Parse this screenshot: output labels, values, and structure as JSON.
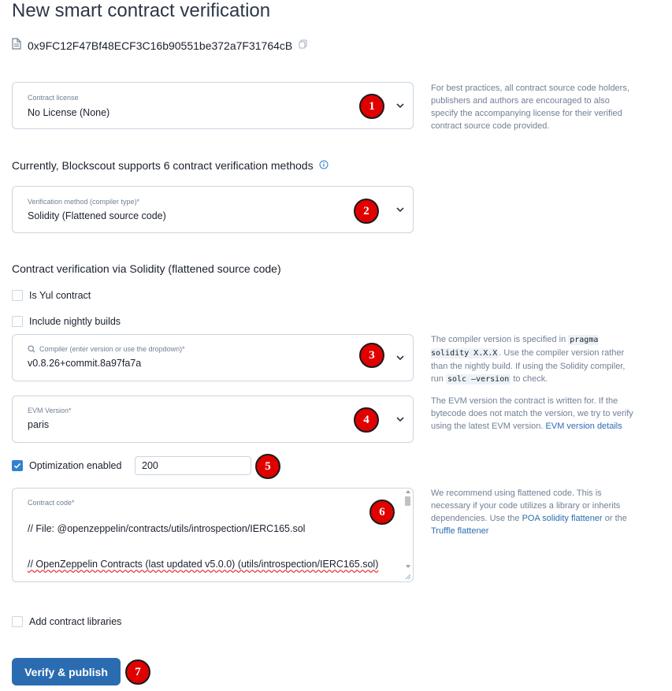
{
  "page": {
    "title": "New smart contract verification"
  },
  "address": {
    "value": "0x9FC12F47Bf48ECF3C16b90551be372a7F31764cB"
  },
  "license": {
    "label": "Contract license",
    "value": "No License (None)",
    "help": "For best practices, all contract source code holders, publishers and authors are encouraged to also specify the accompanying license for their verified contract source code provided."
  },
  "methods_heading": "Currently, Blockscout supports 6 contract verification methods",
  "method": {
    "label": "Verification method (compiler type)*",
    "value": "Solidity (Flattened source code)"
  },
  "section_heading": "Contract verification via Solidity (flattened source code)",
  "checkboxes": {
    "yul": "Is Yul contract",
    "nightly": "Include nightly builds"
  },
  "compiler": {
    "label": "Compiler (enter version or use the dropdown)*",
    "value": "v0.8.26+commit.8a97fa7a",
    "help_1": "The compiler version is specified in",
    "help_code_1": "pragma solidity X.X.X",
    "help_2": ". Use the compiler version rather than the nightly build. If using the Solidity compiler, run",
    "help_code_2": "solc —version",
    "help_3": "to check."
  },
  "evm": {
    "label": "EVM Version*",
    "value": "paris",
    "help": "The EVM version the contract is written for. If the bytecode does not match the version, we try to verify using the latest EVM version.",
    "help_link": "EVM version details"
  },
  "optimization": {
    "label": "Optimization enabled",
    "runs": "200"
  },
  "code": {
    "label": "Contract code*",
    "line1": "// File: @openzeppelin/contracts/utils/introspection/IERC165.sol",
    "line2": "// OpenZeppelin Contracts (last updated v5.0.0) (utils/introspection/IERC165.sol)",
    "help_1": "We recommend using flattened code. This is necessary if your code utilizes a library or inherits dependencies. Use the",
    "help_link1": "POA solidity flattener",
    "help_2": "or the",
    "help_link2": "Truffle flattener"
  },
  "libraries": {
    "label": "Add contract libraries"
  },
  "submit": {
    "label": "Verify & publish"
  },
  "badges": [
    "1",
    "2",
    "3",
    "4",
    "5",
    "6",
    "7"
  ],
  "colors": {
    "primary": "#2b6cb0",
    "badge": "#e00000",
    "border": "#cbd5e0"
  }
}
